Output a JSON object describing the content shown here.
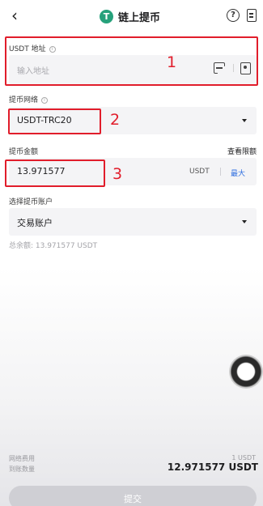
{
  "header": {
    "title": "链上提币",
    "logo_glyph": "T",
    "icons": [
      "back-icon",
      "help-icon",
      "record-icon"
    ]
  },
  "address": {
    "label": "USDT 地址",
    "placeholder": "输入地址",
    "annotation": "1"
  },
  "network": {
    "label": "提币网络",
    "value": "USDT-TRC20",
    "annotation": "2"
  },
  "amount": {
    "label": "提币金额",
    "link": "查看限额",
    "value": "13.971577",
    "unit": "USDT",
    "max_label": "最大",
    "annotation": "3"
  },
  "account": {
    "label": "选择提币账户",
    "value": "交易账户",
    "available": "总余额: 13.971577 USDT"
  },
  "summary": {
    "fee_label": "网络费用",
    "fee_value": "1 USDT",
    "receive_label": "到账数量",
    "receive_value": "12.971577 USDT"
  },
  "submit": {
    "label": "提交"
  },
  "colors": {
    "annotation_red": "#e11d2b",
    "link_blue": "#2f6fe0",
    "tether_green": "#26a17b"
  }
}
